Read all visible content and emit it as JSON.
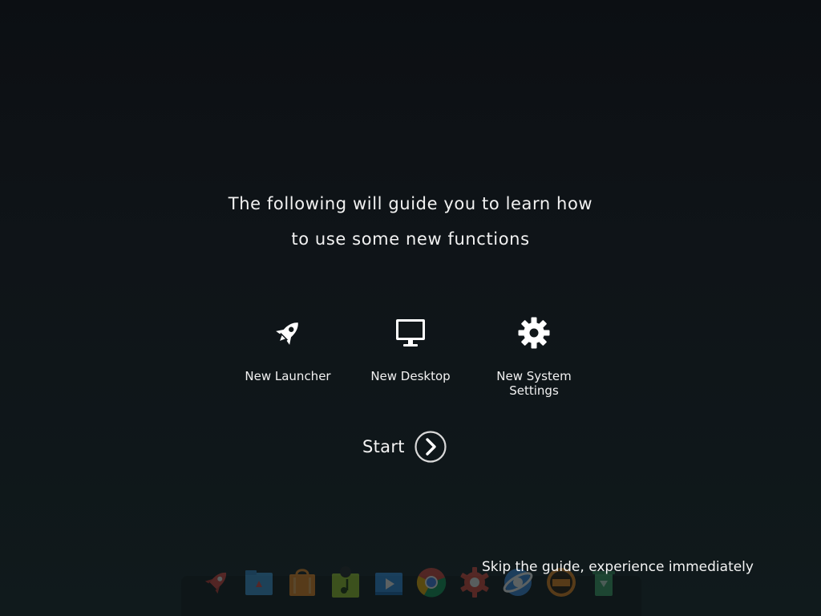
{
  "guide": {
    "line1": "The following will guide you to learn how",
    "line2": "to use some new functions"
  },
  "features": [
    {
      "label": "New Launcher",
      "icon": "rocket-icon"
    },
    {
      "label": "New Desktop",
      "icon": "monitor-icon"
    },
    {
      "label": "New System Settings",
      "icon": "gear-icon"
    }
  ],
  "start": {
    "label": "Start",
    "icon": "chevron-right-circle-icon"
  },
  "skip": {
    "label": "Skip the guide, experience immediately"
  },
  "dock": {
    "items": [
      {
        "icon": "launcher-rocket-icon"
      },
      {
        "icon": "file-manager-icon"
      },
      {
        "icon": "app-store-icon"
      },
      {
        "icon": "music-player-icon"
      },
      {
        "icon": "video-player-icon"
      },
      {
        "icon": "chrome-browser-icon"
      },
      {
        "icon": "control-center-icon"
      },
      {
        "icon": "browser-icon"
      },
      {
        "icon": "clock-icon"
      },
      {
        "icon": "trash-icon"
      }
    ]
  },
  "colors": {
    "background": "#0e1417",
    "text": "#f2f2f2",
    "start_circle": "#d9d9d9"
  }
}
